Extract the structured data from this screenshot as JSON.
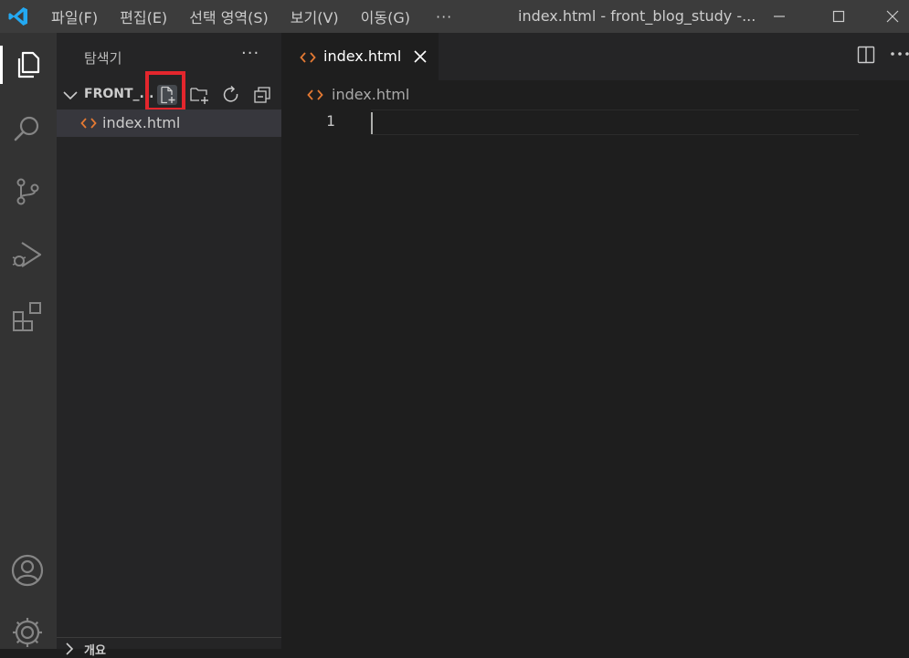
{
  "titlebar": {
    "menus": [
      "파일(F)",
      "편집(E)",
      "선택 영역(S)",
      "보기(V)",
      "이동(G)"
    ],
    "more": "···",
    "window_title": "index.html - front_blog_study -..."
  },
  "sidebar": {
    "title": "탐색기",
    "more": "···",
    "folder_name": "FRONT_...",
    "files": [
      {
        "name": "index.html",
        "icon": "html-file-icon"
      }
    ],
    "bottom_section": "개요"
  },
  "editor": {
    "tab_label": "index.html",
    "breadcrumb": "index.html",
    "line_numbers": [
      "1"
    ]
  },
  "colors": {
    "accent_html": "#e37933",
    "highlight_box": "#e3262d",
    "vscode_blue": "#23a9f2"
  }
}
